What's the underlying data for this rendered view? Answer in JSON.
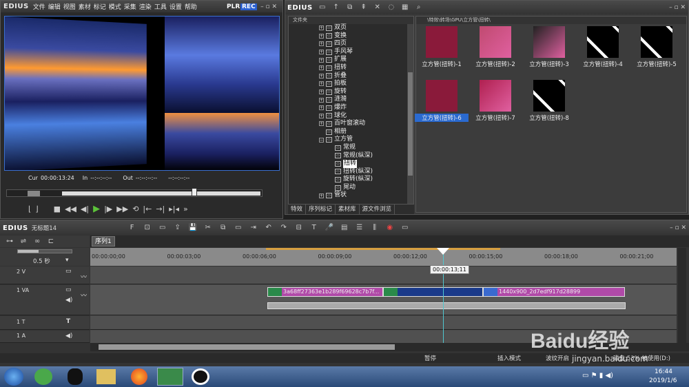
{
  "app": {
    "name": "EDIUS",
    "menu": [
      "文件",
      "编辑",
      "视图",
      "素材",
      "标记",
      "模式",
      "采集",
      "渲染",
      "工具",
      "设置",
      "帮助"
    ],
    "plr": "PLR",
    "rec": "REC"
  },
  "player": {
    "cur_label": "Cur",
    "cur": "00:00:13:24",
    "in_label": "In",
    "in": "--:--:--:--",
    "out_label": "Out",
    "out": "--:--:--:--",
    "dur": "--:--:--:--"
  },
  "bin": {
    "title": "EDIUS",
    "folder_header": "文件夹",
    "path": "\\特效\\转场\\GPU\\立方管\\扭转\\",
    "tree": [
      {
        "label": "双页",
        "type": "plus",
        "indent": 0
      },
      {
        "label": "变换",
        "type": "plus",
        "indent": 0
      },
      {
        "label": "四页",
        "type": "plus",
        "indent": 0
      },
      {
        "label": "手风琴",
        "type": "plus",
        "indent": 0
      },
      {
        "label": "扩展",
        "type": "plus",
        "indent": 0
      },
      {
        "label": "扭转",
        "type": "plus",
        "indent": 0
      },
      {
        "label": "折叠",
        "type": "plus",
        "indent": 0
      },
      {
        "label": "拍板",
        "type": "plus",
        "indent": 0
      },
      {
        "label": "旋转",
        "type": "plus",
        "indent": 0
      },
      {
        "label": "涟漪",
        "type": "plus",
        "indent": 0
      },
      {
        "label": "爆炸",
        "type": "plus",
        "indent": 0
      },
      {
        "label": "球化",
        "type": "plus",
        "indent": 0
      },
      {
        "label": "百叶窗滚动",
        "type": "plus",
        "indent": 0
      },
      {
        "label": "相册",
        "type": "none",
        "indent": 0
      },
      {
        "label": "立方管",
        "type": "minus",
        "indent": 0
      },
      {
        "label": "常规",
        "type": "none",
        "indent": 1
      },
      {
        "label": "常规(纵深)",
        "type": "none",
        "indent": 1
      },
      {
        "label": "扭转",
        "type": "none",
        "indent": 1,
        "selected": true
      },
      {
        "label": "扭转(纵深)",
        "type": "none",
        "indent": 1
      },
      {
        "label": "旋转(纵深)",
        "type": "none",
        "indent": 1
      },
      {
        "label": "晃动",
        "type": "none",
        "indent": 1
      },
      {
        "label": "管状",
        "type": "plus",
        "indent": 0
      }
    ],
    "tabs": [
      "特效",
      "序列标记",
      "素材库",
      "源文件浏览"
    ],
    "items": [
      "立方管(扭转)-1",
      "立方管(扭转)-2",
      "立方管(扭转)-3",
      "立方管(扭转)-4",
      "立方管(扭转)-5",
      "立方管(扭转)-6",
      "立方管(扭转)-7",
      "立方管(扭转)-8"
    ]
  },
  "timeline": {
    "title": "EDIUS",
    "project": "无标题14",
    "sequence_tab": "序列1",
    "zoom": "0.5 秒",
    "ruler": [
      "00:00:00;00",
      "00:00:03;00",
      "00:00:06;00",
      "00:00:09;00",
      "00:00:12;00",
      "00:00:15;00",
      "00:00:18;00",
      "00:00:21;00"
    ],
    "cursor_time": "00:00:13;11",
    "tracks": [
      {
        "name": "2 V"
      },
      {
        "name": "1 VA"
      },
      {
        "name": "1 T"
      },
      {
        "name": "1 A"
      }
    ],
    "clip1": "3a68ff27363e1b289f69628c7b7f...",
    "clip2": "1440x900_2d7edf917d28899"
  },
  "status": {
    "pause": "暂停",
    "insert": "插入模式",
    "ripple": "波纹开启",
    "disk": "磁盘:53% 被使用(D:)"
  },
  "taskbar": {
    "time": "16:44",
    "date": "2019/1/6"
  },
  "watermark": {
    "text": "Baidu经验",
    "url": "jingyan.baidu.com"
  },
  "colors": {
    "accent": "#3a6fd0",
    "clip": "#b04aa8",
    "play": "#5cc23a"
  }
}
